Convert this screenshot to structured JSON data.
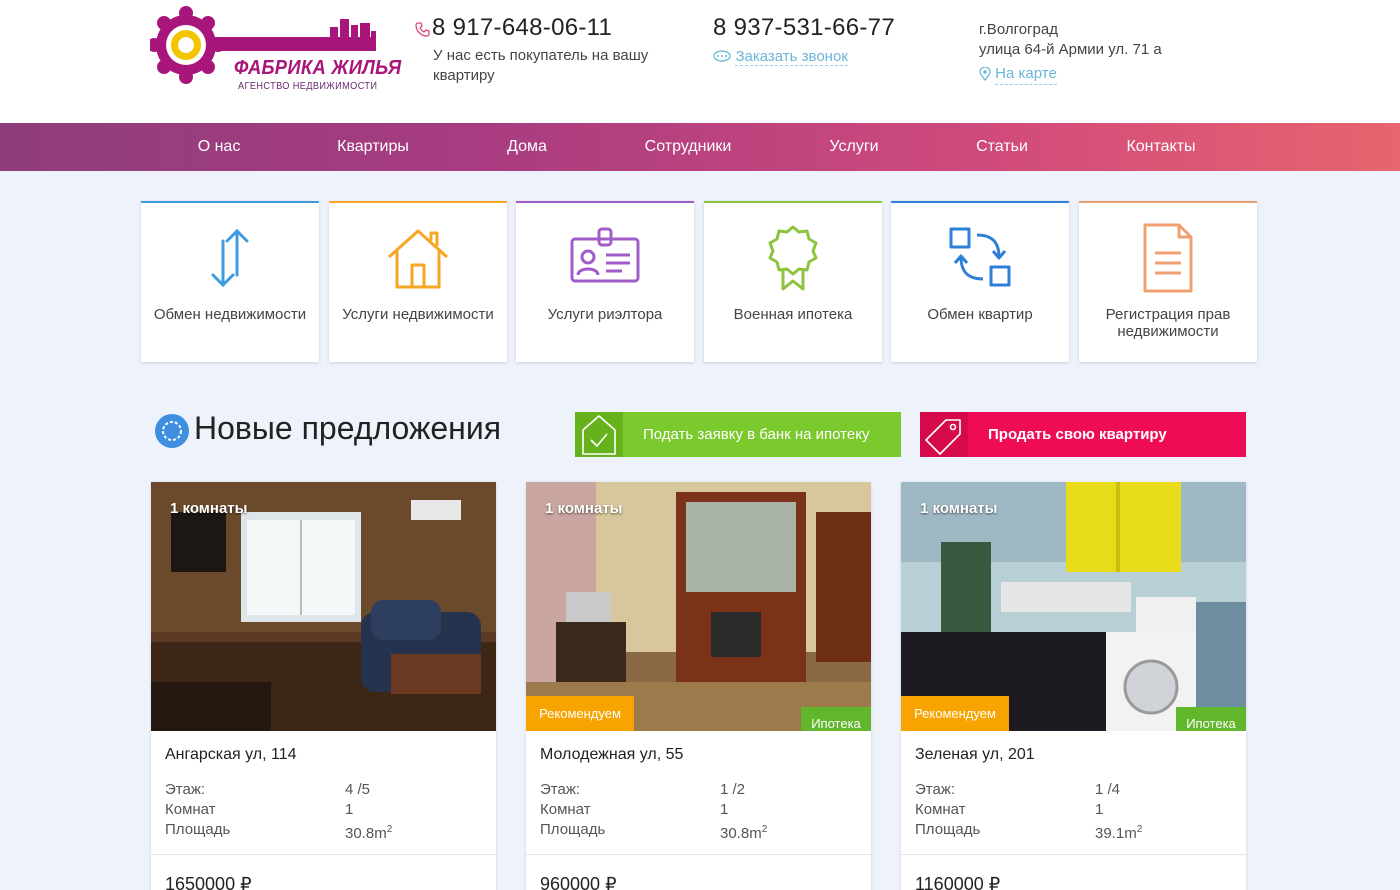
{
  "logo": {
    "title": "ФАБРИКА ЖИЛЬЯ",
    "subtitle": "АГЕНСТВО НЕДВИЖИМОСТИ"
  },
  "header": {
    "phone1": "8 917-648-06-11",
    "phone1_note": "У нас есть покупатель на вашу квартиру",
    "phone2": "8 937-531-66-77",
    "callback": "Заказать звонок",
    "city": "г.Волгоград",
    "street": "улица 64-й Армии ул. 71 а",
    "map_link": "На карте"
  },
  "nav": [
    "О нас",
    "Квартиры",
    "Дома",
    "Сотрудники",
    "Услуги",
    "Статьи",
    "Контакты"
  ],
  "services": [
    {
      "label": "Обмен недвижимости",
      "icon": "exchange-arrows-icon",
      "color": "#3d9be0"
    },
    {
      "label": "Услуги недвижимости",
      "icon": "house-icon",
      "color": "#f5a623"
    },
    {
      "label": "Услуги риэлтора",
      "icon": "id-badge-icon",
      "color": "#a05cc8"
    },
    {
      "label": "Военная ипотека",
      "icon": "award-ribbon-icon",
      "color": "#8dc33f"
    },
    {
      "label": "Обмен квартир",
      "icon": "swap-squares-icon",
      "color": "#2f7fd8"
    },
    {
      "label": "Регистрация прав недвижимости",
      "icon": "document-icon",
      "color": "#f0a070"
    }
  ],
  "section": {
    "title": "Новые предложения",
    "mortgage_btn": "Подать заявку в банк на ипотеку",
    "sell_btn": "Продать свою квартиру"
  },
  "labels": {
    "floor": "Этаж:",
    "rooms": "Комнат",
    "area": "Площадь",
    "recommend": "Рекомендуем",
    "mortgage": "Ипотека"
  },
  "listings": [
    {
      "rooms_badge": "1 комнаты",
      "address": "Ангарская ул, 114",
      "floor": "4 /5",
      "rooms": "1",
      "area": "30.8m",
      "price": "1650000 ₽",
      "recommend": false,
      "mortgage": false
    },
    {
      "rooms_badge": "1 комнаты",
      "address": "Молодежная ул, 55",
      "floor": "1 /2",
      "rooms": "1",
      "area": "30.8m",
      "price": "960000 ₽",
      "recommend": true,
      "mortgage": true
    },
    {
      "rooms_badge": "1 комнаты",
      "address": "Зеленая ул, 201",
      "floor": "1 /4",
      "rooms": "1",
      "area": "39.1m",
      "price": "1160000 ₽",
      "recommend": true,
      "mortgage": true
    }
  ],
  "area_sup": "2"
}
